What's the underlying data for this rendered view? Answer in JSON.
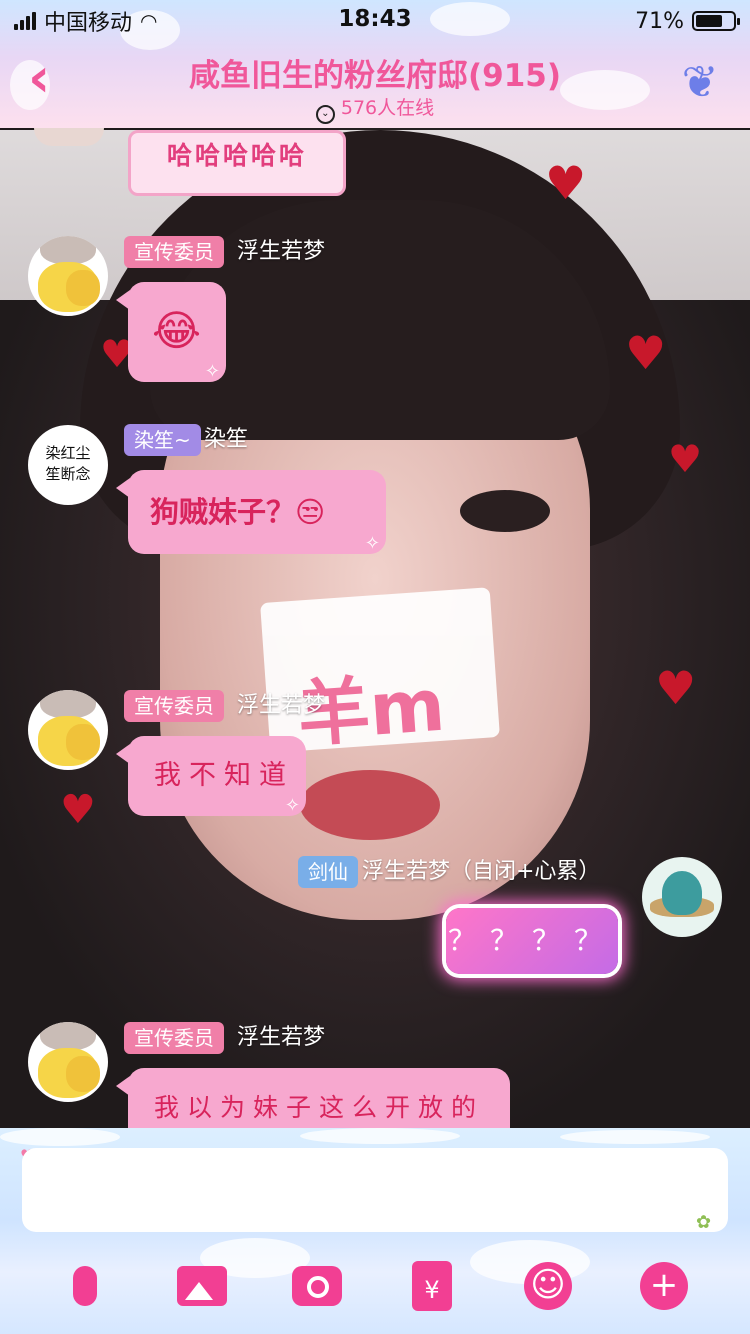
{
  "status": {
    "carrier": "中国移动",
    "time": "18:43",
    "battery": "71%"
  },
  "header": {
    "title": "咸鱼旧生的粉丝府邸(915)",
    "online": "576人在线",
    "back_icon": "back-chevron-icon",
    "corner_icon": "butterfly-icon"
  },
  "messages": [
    {
      "text": "哈哈哈哈哈"
    },
    {
      "tag": "宣传委员",
      "sender": "浮生若梦",
      "content": "😂"
    },
    {
      "tag": "染笙~",
      "sender": "染笙",
      "avatar_text": [
        "染红尘",
        "笙断念"
      ],
      "text": "狗贼妹子？😒"
    },
    {
      "tag": "宣传委员",
      "sender": "浮生若梦",
      "text": "我不知道"
    },
    {
      "tag": "剑仙",
      "sender": "浮生若梦（自闭+心累）",
      "text": "？？？？"
    },
    {
      "tag": "宣传委员",
      "sender": "浮生若梦",
      "text": "我以为妹子这么开放的"
    }
  ],
  "input": {
    "value": ""
  },
  "toolbar": {
    "items": [
      "mic-icon",
      "image-icon",
      "camera-icon",
      "red-packet-icon",
      "emoji-icon",
      "plus-icon"
    ],
    "red_packet_symbol": "¥",
    "emoji_symbol": "☺",
    "plus_symbol": "+"
  },
  "colors": {
    "accent": "#f0579a",
    "bubble": "#f7a8cf",
    "toolbar_icon": "#f23f93"
  }
}
